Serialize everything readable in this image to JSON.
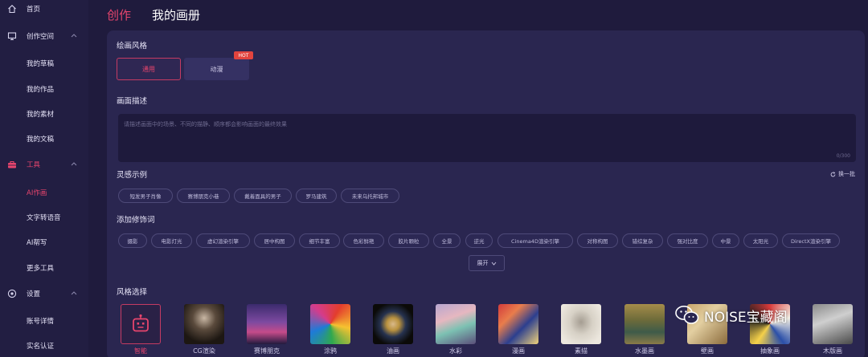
{
  "sidebar": {
    "items": [
      {
        "label": "首页",
        "icon": "home-icon"
      },
      {
        "label": "创作空间",
        "icon": "monitor-icon",
        "expanded": true
      },
      {
        "label": "我的草稿"
      },
      {
        "label": "我的作品"
      },
      {
        "label": "我的素材"
      },
      {
        "label": "我的文稿"
      },
      {
        "label": "工具",
        "icon": "toolbox-icon",
        "expanded": true
      },
      {
        "label": "AI作画",
        "active": true
      },
      {
        "label": "文字转语音"
      },
      {
        "label": "AI帮写"
      },
      {
        "label": "更多工具"
      },
      {
        "label": "设置",
        "icon": "settings-icon",
        "expanded": true
      },
      {
        "label": "账号详情"
      },
      {
        "label": "实名认证"
      }
    ]
  },
  "header": {
    "tab_create": "创作",
    "tab_album": "我的画册"
  },
  "painting_style": {
    "title": "绘画风格",
    "options": [
      "通用",
      "动漫"
    ],
    "selected": "通用",
    "hot_badge": "HOT"
  },
  "description": {
    "title": "画面描述",
    "placeholder": "请描述画面中的场景、不同的描静、顺序都会影响画面的最终效果",
    "char_count": "0/300"
  },
  "inspiration": {
    "title": "灵感示例",
    "refresh_label": "换一批",
    "chips": [
      "短发男子肖像",
      "赛博朋克小巷",
      "戴着面具的男子",
      "罗马建筑",
      "未来乌托邦城市"
    ]
  },
  "modifiers": {
    "title": "添加修饰词",
    "chips": [
      "摄影",
      "电影灯光",
      "虚幻渲染引擎",
      "居中构图",
      "细节丰富",
      "色彩鲜艳",
      "胶片颗粒",
      "全景",
      "逆光",
      "Cinema4D渲染引擎",
      "对称构图",
      "错综复杂",
      "强对比度",
      "中景",
      "太阳光",
      "DirectX渲染引擎"
    ],
    "expand_label": "展开"
  },
  "style_select": {
    "title": "风格选择",
    "styles": [
      "智能",
      "CG渲染",
      "赛博朋克",
      "涂鸦",
      "油画",
      "水彩",
      "漫画",
      "素描",
      "水墨画",
      "壁画",
      "抽象画",
      "木版画"
    ],
    "selected": "智能"
  },
  "watermark": {
    "text": "NOISE宝藏阁"
  },
  "colors": {
    "accent": "#e8456d",
    "sidebar_bg": "#221e42",
    "page_bg": "#1f1b3d",
    "panel_bg": "#2a2650"
  }
}
